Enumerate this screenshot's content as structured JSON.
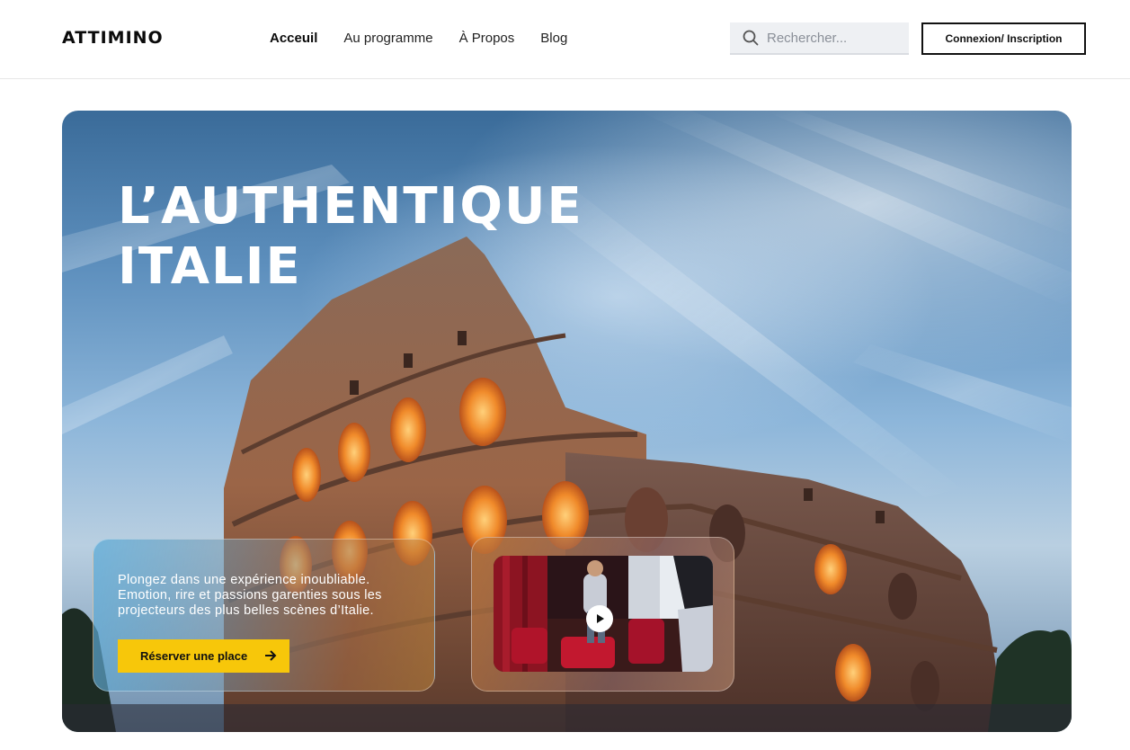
{
  "brand": {
    "logo_text": "ATTIMINO"
  },
  "nav": {
    "items": [
      {
        "label": "Acceuil",
        "active": true
      },
      {
        "label": "Au programme",
        "active": false
      },
      {
        "label": "À Propos",
        "active": false
      },
      {
        "label": "Blog",
        "active": false
      }
    ]
  },
  "search": {
    "placeholder": "Rechercher...",
    "value": "",
    "icon": "search-icon"
  },
  "auth": {
    "button_label": "Connexion/ Inscription"
  },
  "hero": {
    "title_line1": "L’AUTHENTIQUE",
    "title_line2": "ITALIE",
    "card_text": "Plongez dans une expérience inoubliable. Emotion, rire et passions garenties sous les projecteurs des plus belles scènes d’Italie.",
    "cta_label": "Réserver une place",
    "cta_icon": "arrow-right-icon",
    "video_icon": "play-icon"
  },
  "colors": {
    "accent": "#f7c70a",
    "text_dark": "#111111",
    "search_bg": "#eef0f3"
  }
}
